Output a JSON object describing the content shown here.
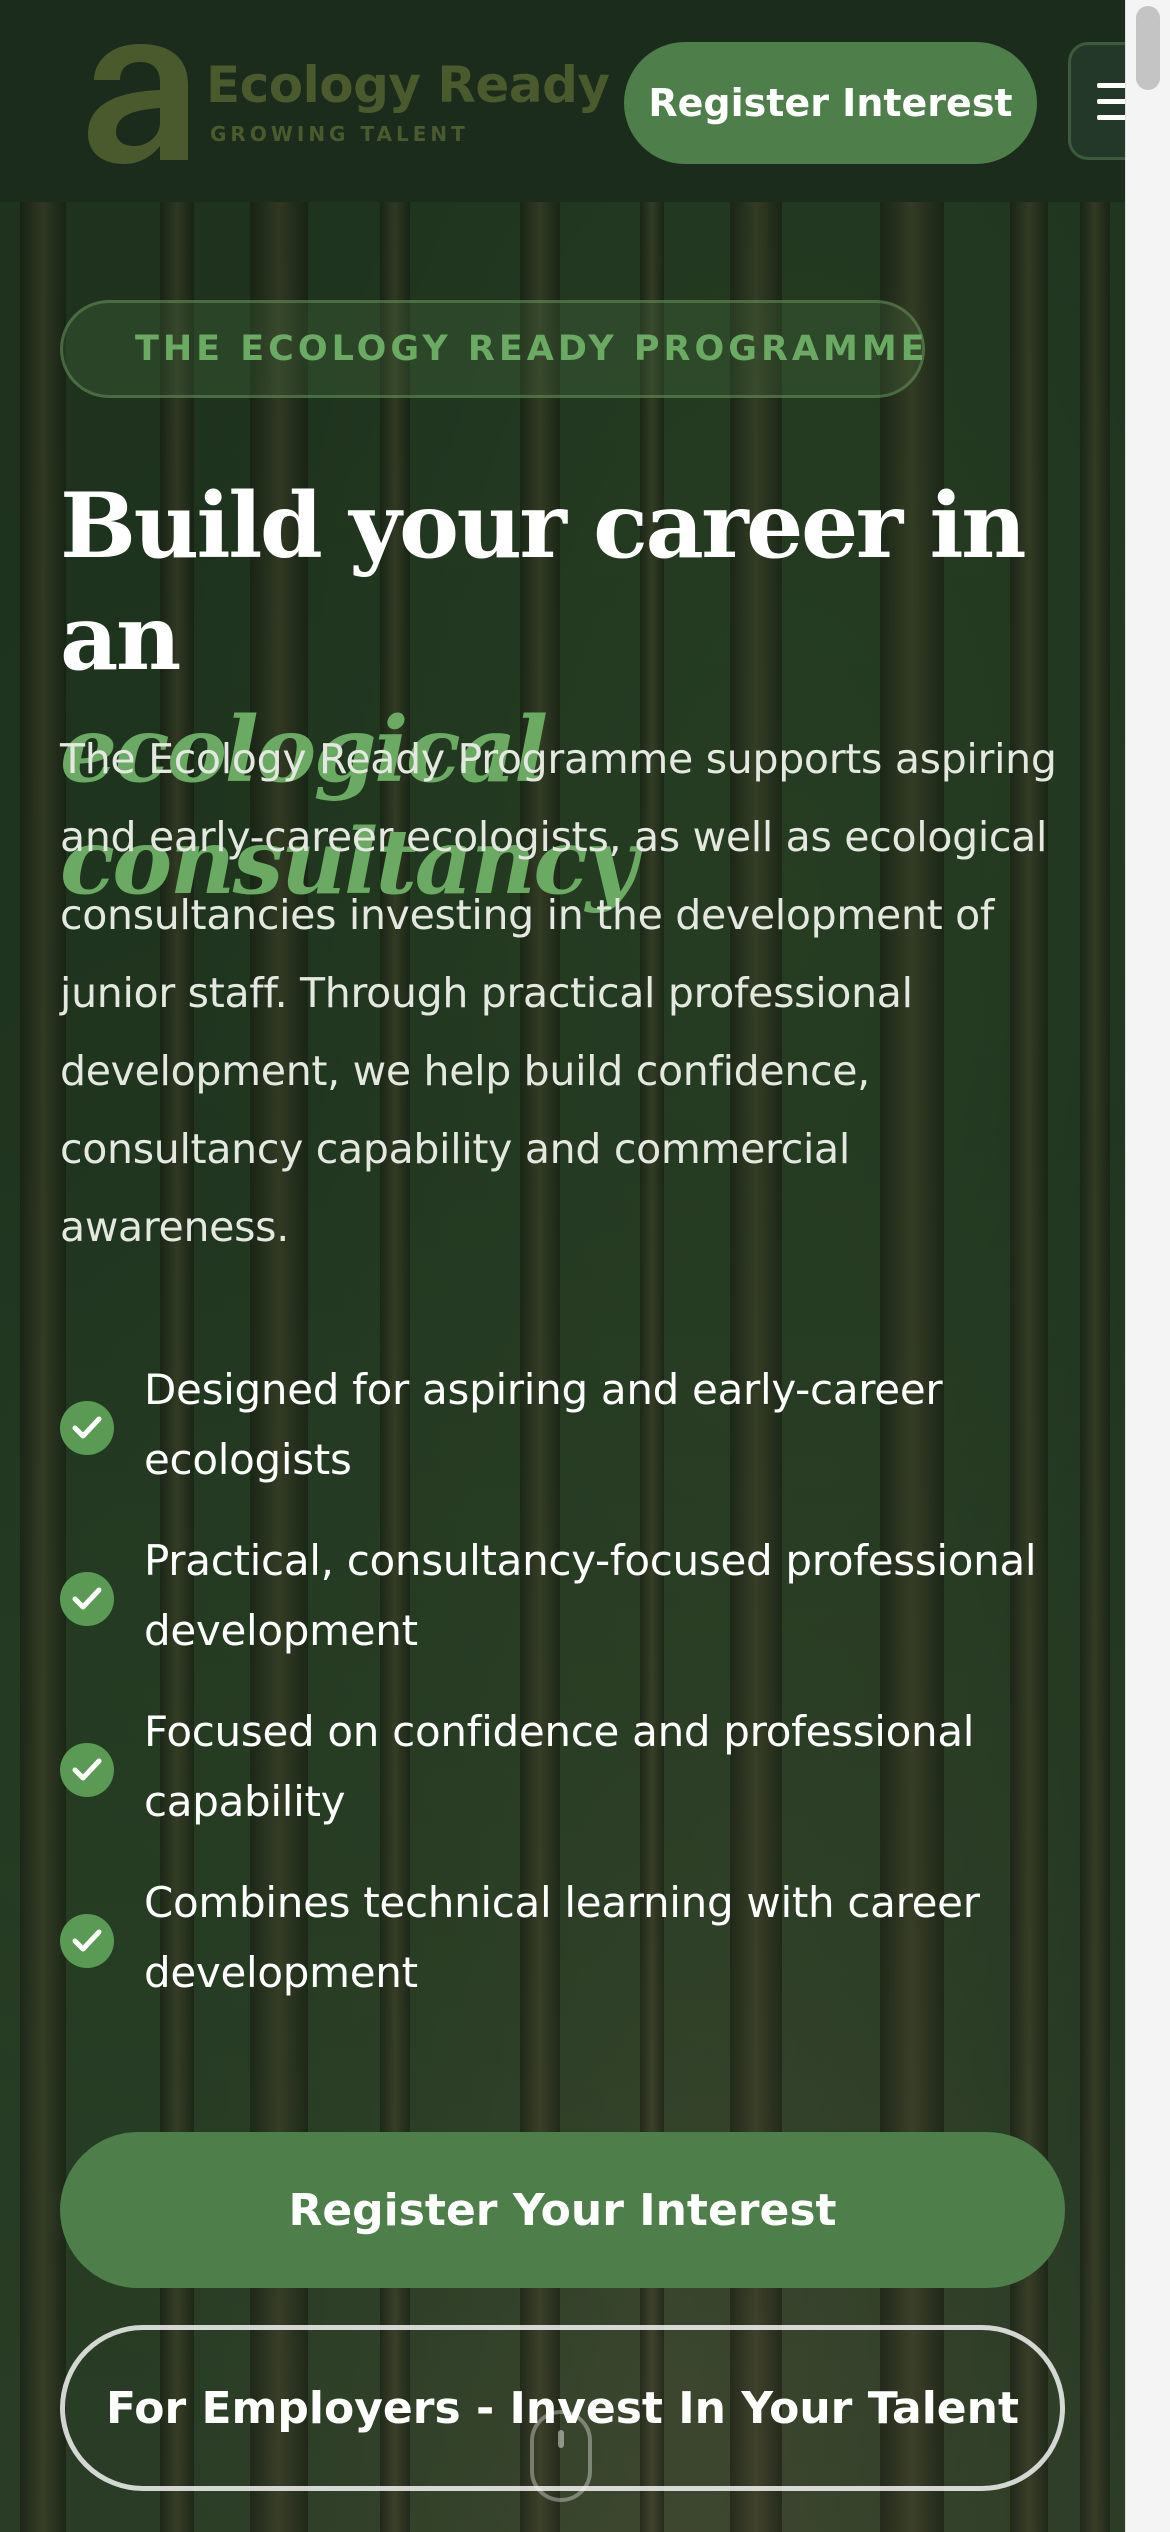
{
  "header": {
    "logo": {
      "name": "Ecology Ready",
      "tagline": "GROWING TALENT",
      "mark": "a"
    },
    "register_label": "Register Interest",
    "menu_icon": "hamburger-menu-icon"
  },
  "hero": {
    "badge": "THE ECOLOGY READY PROGRAMME",
    "heading_line1": "Build your career in an",
    "heading_accent": "ecological consultancy",
    "intro": "The Ecology Ready Programme supports aspiring and early-career ecologists, as well as ecological consultancies investing in the development of junior staff. Through practical professional development, we help build confidence, consultancy capability and commercial awareness.",
    "features": [
      {
        "icon": "check-icon",
        "text": "Designed for aspiring and early-career ecologists"
      },
      {
        "icon": "check-icon",
        "text": "Practical, consultancy-focused professional development"
      },
      {
        "icon": "check-icon",
        "text": "Focused on confidence and professional capability"
      },
      {
        "icon": "check-icon",
        "text": "Combines technical learning with career development"
      }
    ],
    "cta_primary": "Register Your Interest",
    "cta_secondary": "For Employers - Invest In Your Talent",
    "scroll_icon": "mouse-scroll-icon"
  },
  "colors": {
    "brand_green": "#4e7e4a",
    "accent_green": "#6aaa62",
    "header_bg": "#1b2c1d"
  }
}
